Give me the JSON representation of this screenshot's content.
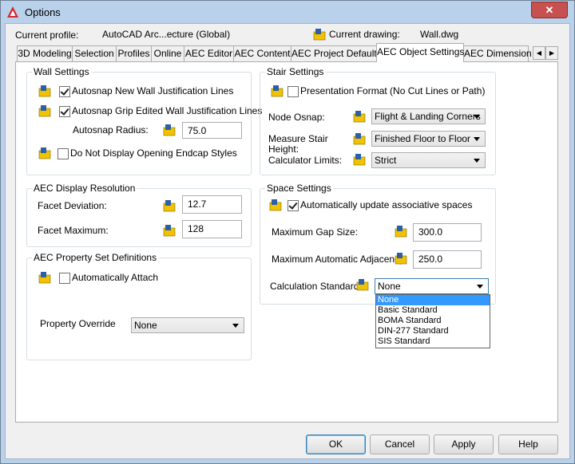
{
  "window": {
    "title": "Options",
    "close_glyph": "✕"
  },
  "header": {
    "current_profile_label": "Current profile:",
    "current_profile_value": "AutoCAD Arc...ecture (Global)",
    "current_drawing_label": "Current drawing:",
    "current_drawing_value": "Wall.dwg"
  },
  "tabs": [
    {
      "label": "3D Modeling"
    },
    {
      "label": "Selection"
    },
    {
      "label": "Profiles"
    },
    {
      "label": "Online"
    },
    {
      "label": "AEC Editor"
    },
    {
      "label": "AEC Content"
    },
    {
      "label": "AEC Project Defaults"
    },
    {
      "label": "AEC Object Settings"
    },
    {
      "label": "AEC Dimension"
    }
  ],
  "active_tab": "AEC Object Settings",
  "wall_settings": {
    "title": "Wall Settings",
    "autosnap_new": "Autosnap New Wall Justification Lines",
    "autosnap_new_checked": true,
    "autosnap_grip": "Autosnap Grip Edited Wall Justification Lines",
    "autosnap_grip_checked": true,
    "autosnap_radius_label": "Autosnap Radius:",
    "autosnap_radius_value": "75.0",
    "no_endcap": "Do Not Display Opening Endcap Styles",
    "no_endcap_checked": false
  },
  "display_resolution": {
    "title": "AEC Display Resolution",
    "facet_deviation_label": "Facet Deviation:",
    "facet_deviation_value": "12.7",
    "facet_maximum_label": "Facet Maximum:",
    "facet_maximum_value": "128"
  },
  "property_sets": {
    "title": "AEC Property Set Definitions",
    "auto_attach": "Automatically Attach",
    "auto_attach_checked": false,
    "override_label": "Property Override",
    "override_value": "None"
  },
  "stair_settings": {
    "title": "Stair Settings",
    "presentation": "Presentation Format (No Cut Lines or Path)",
    "presentation_checked": false,
    "node_osnap_label": "Node Osnap:",
    "node_osnap_value": "Flight & Landing Corners",
    "measure_label_1": "Measure Stair",
    "measure_label_2": "Height:",
    "measure_value": "Finished Floor to Floor",
    "calc_limits_label": "Calculator Limits:",
    "calc_limits_value": "Strict"
  },
  "space_settings": {
    "title": "Space Settings",
    "auto_update": "Automatically update associative spaces",
    "auto_update_checked": true,
    "max_gap_label": "Maximum Gap Size:",
    "max_gap_value": "300.0",
    "max_adjacency_label": "Maximum Automatic Adjacency",
    "max_adjacency_value": "250.0",
    "calc_standard_label": "Calculation Standard:",
    "calc_standard_value": "None",
    "calc_standard_options": [
      "None",
      "Basic Standard",
      "BOMA Standard",
      "DIN-277 Standard",
      "SIS Standard"
    ]
  },
  "buttons": {
    "ok": "OK",
    "cancel": "Cancel",
    "apply": "Apply",
    "help": "Help"
  },
  "colors": {
    "frame": "#b9d1ea",
    "close": "#c75050",
    "selection": "#3399ff",
    "app_red": "#d42b2b"
  }
}
